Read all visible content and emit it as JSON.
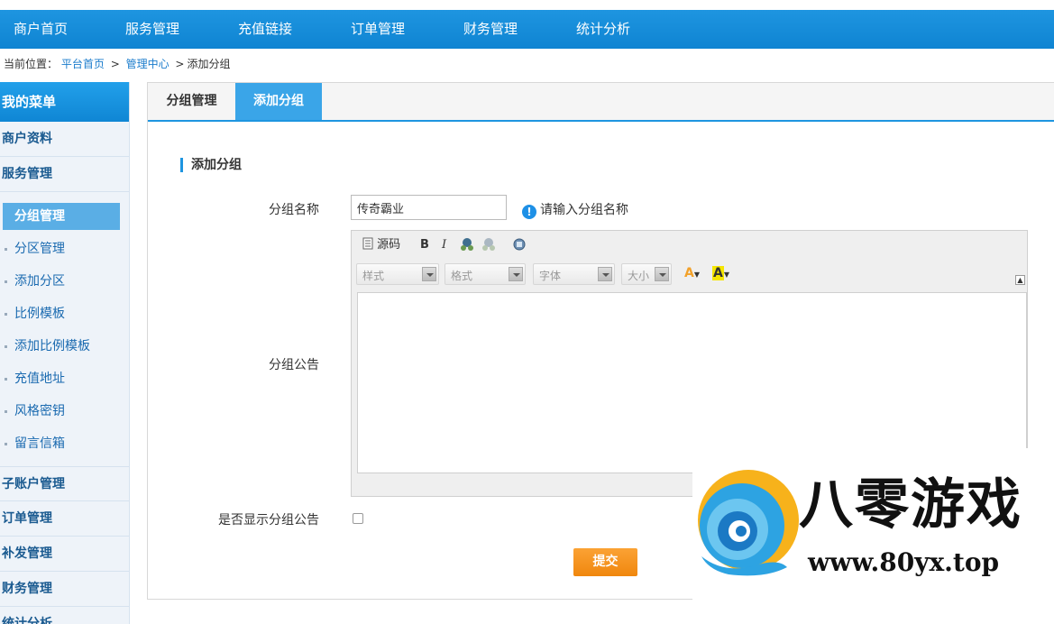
{
  "topnav": {
    "items": [
      "商户首页",
      "服务管理",
      "充值链接",
      "订单管理",
      "财务管理",
      "统计分析"
    ]
  },
  "breadcrumb": {
    "prefix": "当前位置：",
    "home": "平台首页",
    "center": "管理中心",
    "current": "添加分组",
    "sep1": ">",
    "sep2": ">"
  },
  "sidebar": {
    "header": "我的菜单",
    "profile": "商户资料",
    "service": "服务管理",
    "subitems": [
      "分组管理",
      "分区管理",
      "添加分区",
      "比例模板",
      "添加比例模板",
      "充值地址",
      "风格密钥",
      "留言信箱"
    ],
    "subaccount": "子账户管理",
    "orders": "订单管理",
    "resend": "补发管理",
    "finance": "财务管理",
    "stats": "统计分析"
  },
  "tabs": {
    "manage": "分组管理",
    "add": "添加分组"
  },
  "form": {
    "section_title": "添加分组",
    "name_label": "分组名称",
    "name_value": "传奇霸业",
    "name_hint": "请输入分组名称",
    "notice_label": "分组公告",
    "show_notice_label": "是否显示分组公告",
    "show_notice_checked": false,
    "submit": "提交"
  },
  "editor": {
    "source": "源码",
    "bold": "B",
    "italic": "I",
    "style": "样式",
    "format": "格式",
    "font": "字体",
    "size": "大小",
    "text_color": "A",
    "bg_color": "A",
    "icons": [
      "source-icon",
      "bold-icon",
      "italic-icon",
      "link-icon",
      "unlink-icon",
      "maximize-icon"
    ]
  },
  "watermark": {
    "name": "八零游戏",
    "url": "www.80yx.top"
  },
  "colors": {
    "primary": "#1e95e0",
    "sidebar_bg": "#eef3f9",
    "submit": "#f39215",
    "active_sub": "#5aaee5"
  }
}
